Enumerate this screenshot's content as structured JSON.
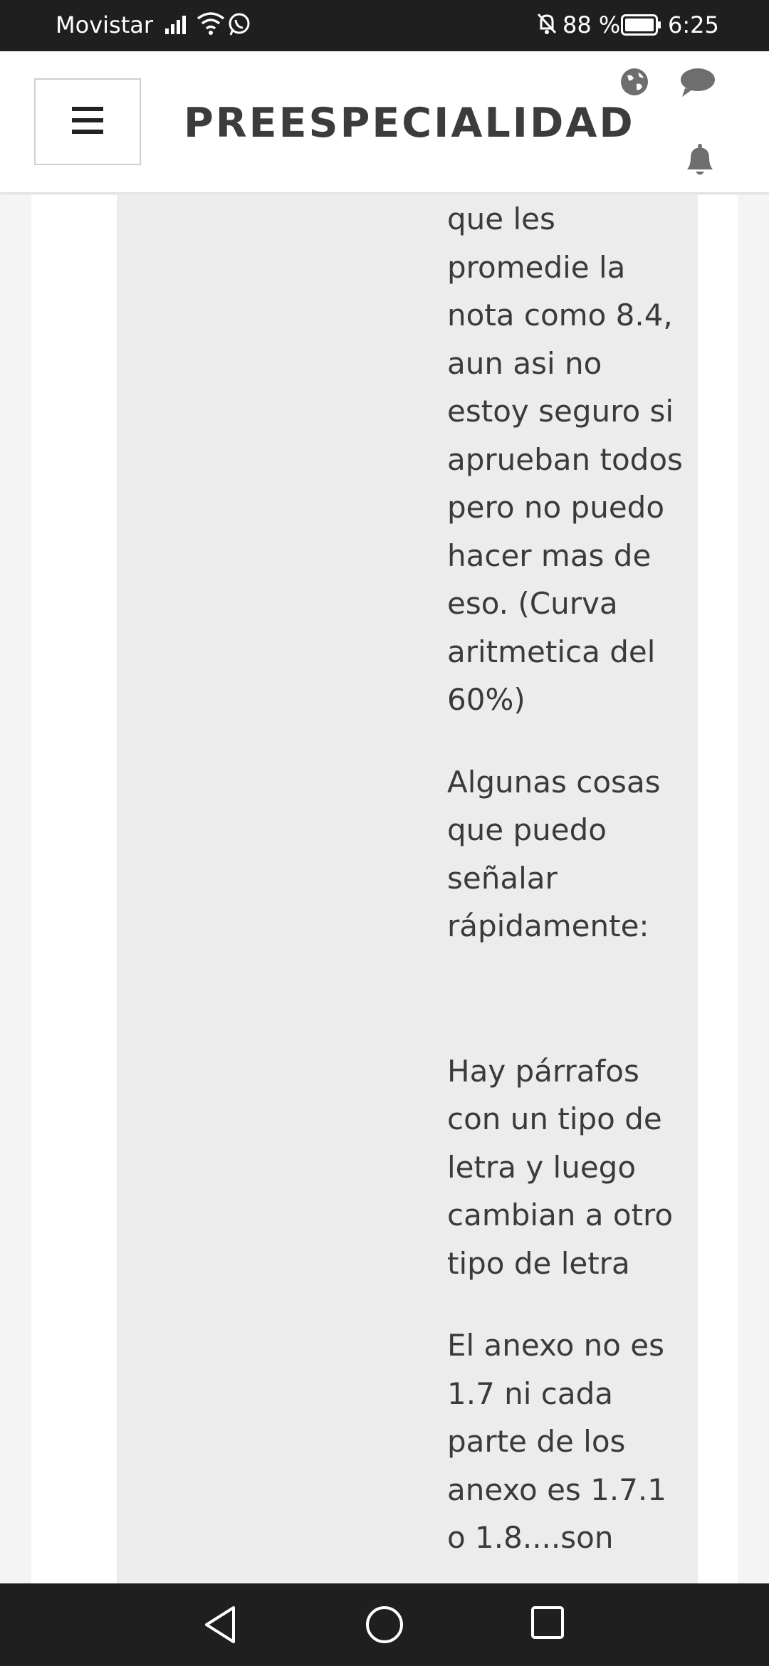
{
  "status_bar": {
    "carrier": "Movistar",
    "battery_percent": "88 %",
    "time": "6:25"
  },
  "header": {
    "title": "PREESPECIALIDAD",
    "menu_icon": "hamburger-menu-icon",
    "icons": [
      "globe-icon",
      "chat-bubble-icon",
      "bell-icon"
    ]
  },
  "post": {
    "paragraphs": [
      "que les promedie la nota como 8.4, aun asi no estoy seguro si aprueban todos pero no puedo hacer mas de eso. (Curva aritmetica del 60%)",
      "Algunas cosas que puedo señalar rápidamente:",
      "Hay párrafos con un tipo de letra y luego cambian a otro tipo de letra",
      "El anexo no es 1.7 ni cada parte de los anexo es 1.7.1 o 1.8....son"
    ]
  },
  "nav_bar": {
    "buttons": [
      "back-icon",
      "home-icon",
      "recents-icon"
    ]
  },
  "colors": {
    "status_bar_bg": "#1f1f1f",
    "header_bg": "#ffffff",
    "title_color": "#3c3c3c",
    "post_bg": "#ececec",
    "text_color": "#3a3a3a"
  }
}
